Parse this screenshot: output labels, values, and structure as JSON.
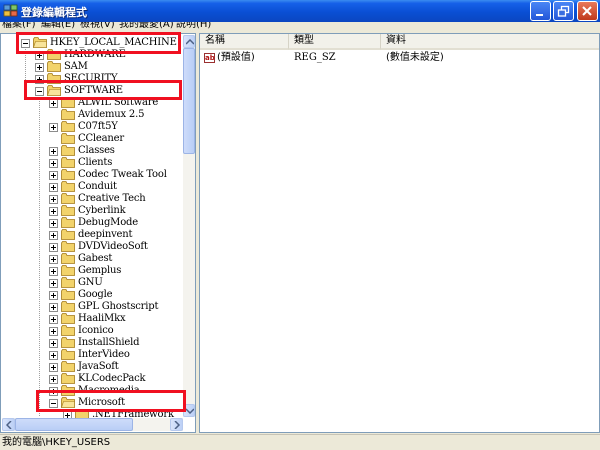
{
  "window": {
    "title": "登錄編輯程式",
    "colors": {
      "titlebar": "#0a4fd4",
      "highlight": "#f01020",
      "folder": "#f2d36b"
    }
  },
  "menu": [
    "檔案(F)",
    "編輯(E)",
    "檢視(V)",
    "我的最愛(A)",
    "說明(H)"
  ],
  "tree": {
    "root": "HKEY_LOCAL_MACHINE",
    "level1": [
      {
        "label": "HARDWARE",
        "expanded": false
      },
      {
        "label": "SAM",
        "expanded": false
      },
      {
        "label": "SECURITY",
        "expanded": false
      },
      {
        "label": "SOFTWARE",
        "expanded": true
      }
    ],
    "software_children": [
      {
        "label": "ALWIL Software",
        "expandable": true
      },
      {
        "label": "Avidemux 2.5",
        "expandable": false
      },
      {
        "label": "C07ft5Y",
        "expandable": true
      },
      {
        "label": "CCleaner",
        "expandable": false
      },
      {
        "label": "Classes",
        "expandable": true
      },
      {
        "label": "Clients",
        "expandable": true
      },
      {
        "label": "Codec Tweak Tool",
        "expandable": true
      },
      {
        "label": "Conduit",
        "expandable": true
      },
      {
        "label": "Creative Tech",
        "expandable": true
      },
      {
        "label": "Cyberlink",
        "expandable": true
      },
      {
        "label": "DebugMode",
        "expandable": true
      },
      {
        "label": "deepinvent",
        "expandable": true
      },
      {
        "label": "DVDVideoSoft",
        "expandable": true
      },
      {
        "label": "Gabest",
        "expandable": true
      },
      {
        "label": "Gemplus",
        "expandable": true
      },
      {
        "label": "GNU",
        "expandable": true
      },
      {
        "label": "Google",
        "expandable": true
      },
      {
        "label": "GPL Ghostscript",
        "expandable": true
      },
      {
        "label": "HaaliMkx",
        "expandable": true
      },
      {
        "label": "Iconico",
        "expandable": true
      },
      {
        "label": "InstallShield",
        "expandable": true
      },
      {
        "label": "InterVideo",
        "expandable": true
      },
      {
        "label": "JavaSoft",
        "expandable": true
      },
      {
        "label": "KLCodecPack",
        "expandable": true
      },
      {
        "label": "Macromedia",
        "expandable": true
      },
      {
        "label": "Microsoft",
        "expandable": true,
        "expanded": true
      }
    ],
    "microsoft_children": [
      ".NETFramework"
    ]
  },
  "values_pane": {
    "headers": {
      "name": "名稱",
      "type": "類型",
      "data": "資料"
    },
    "rows": [
      {
        "icon": "ab",
        "name": "(預設值)",
        "type": "REG_SZ",
        "data": "(數值未設定)"
      }
    ]
  },
  "status": {
    "path": "我的電腦\\HKEY_USERS"
  }
}
